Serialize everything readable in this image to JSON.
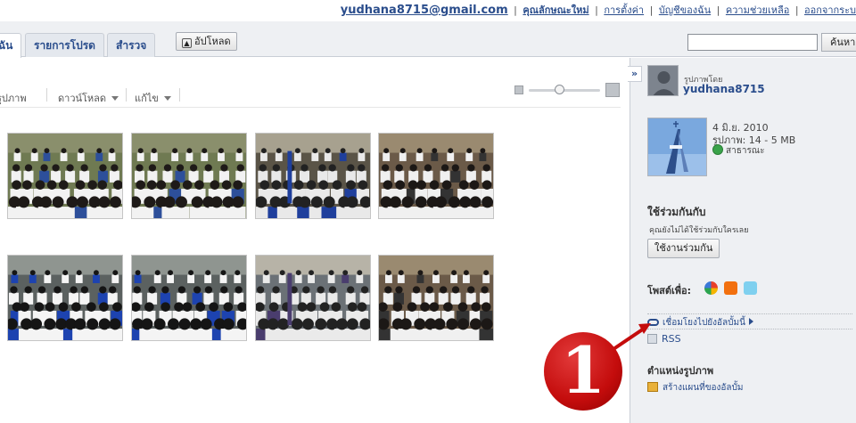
{
  "topbar": {
    "email": "yudhana8715@gmail.com",
    "links": [
      "คุณลักษณะใหม่",
      "การตั้งค่า",
      "บัญชีของฉัน",
      "ความช่วยเหลือ",
      "ออกจากระบ"
    ]
  },
  "tabs": {
    "mine": "ฉัน",
    "favorites": "รายการโปรด",
    "explore": "สำรวจ"
  },
  "upload_label": "อัปโหลด",
  "search": {
    "button": "ค้นหา",
    "value": ""
  },
  "toolbar": {
    "slideshow": "รูปภาพ",
    "download": "ดาวน์โหลด",
    "edit": "แก้ไข"
  },
  "zoom": {
    "level": 0.42
  },
  "photos": [
    {
      "kind": "students-seated"
    },
    {
      "kind": "students-seated"
    },
    {
      "kind": "hall-bleachers"
    },
    {
      "kind": "students-group"
    },
    {
      "kind": "students-blue"
    },
    {
      "kind": "students-blue"
    },
    {
      "kind": "hall-speaker"
    },
    {
      "kind": "students-group"
    }
  ],
  "sidebar": {
    "by_label": "รูปภาพโดย",
    "owner": "yudhana8715",
    "date": "4 มิ.ย. 2010",
    "count": "รูปภาพ: 14 - 5 MB",
    "visibility": "สาธารณะ",
    "share_heading": "ใช้ร่วมกันกับ",
    "share_note": "คุณยังไม่ได้ใช้ร่วมกับใครเลย",
    "share_button": "ใช้งานร่วมกัน",
    "post_heading": "โพสต์เพื่อ:",
    "link_label": "เชื่อมโยงไปยังอัลบั้มนี้",
    "rss_label": "RSS",
    "location_heading": "ตำแหน่งรูปภาพ",
    "map_label": "สร้างแผนที่ของอัลบั้ม"
  },
  "annotation": {
    "number": "1"
  },
  "colors": {
    "link": "#2a4d8c",
    "panel": "#eef0f3",
    "annotation": "#c40c0c"
  }
}
